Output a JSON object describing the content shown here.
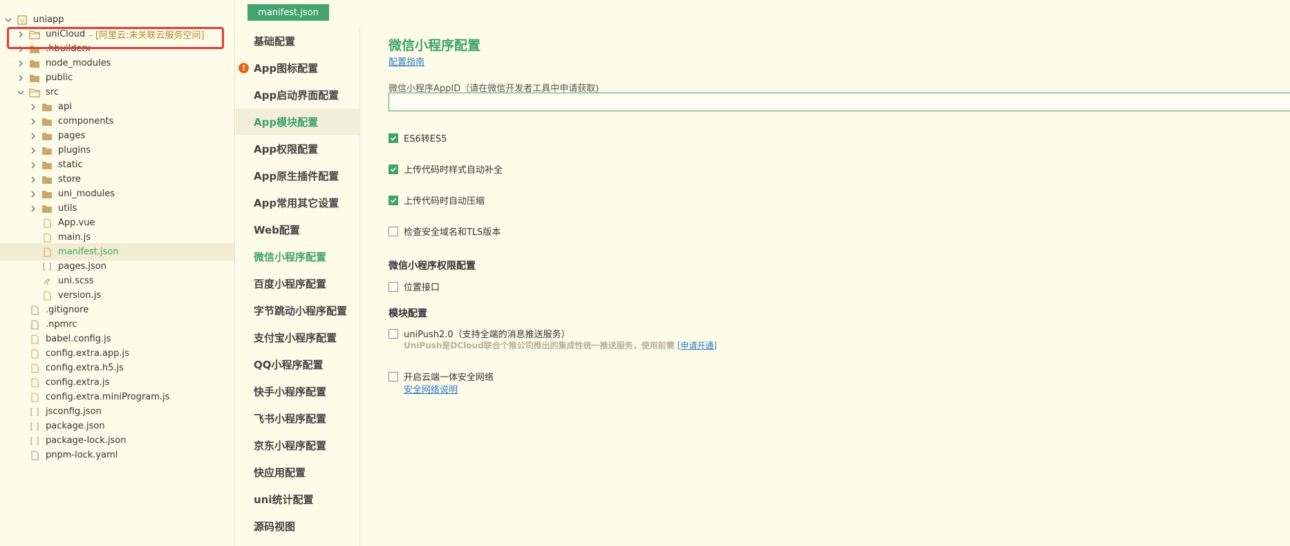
{
  "file_tree": {
    "root": "uniapp",
    "unicloud": {
      "name": "uniCloud",
      "note": "- [阿里云:未关联云服务空间]"
    },
    "items": [
      {
        "name": "uniapp"
      },
      {
        "name": "uniCloud"
      },
      {
        "name": ".hbuilderx"
      },
      {
        "name": "node_modules"
      },
      {
        "name": "public"
      },
      {
        "name": "src"
      },
      {
        "name": "api"
      },
      {
        "name": "components"
      },
      {
        "name": "pages"
      },
      {
        "name": "plugins"
      },
      {
        "name": "static"
      },
      {
        "name": "store"
      },
      {
        "name": "uni_modules"
      },
      {
        "name": "utils"
      },
      {
        "name": "App.vue"
      },
      {
        "name": "main.js"
      },
      {
        "name": "manifest.json"
      },
      {
        "name": "pages.json"
      },
      {
        "name": "uni.scss"
      },
      {
        "name": "version.js"
      },
      {
        "name": ".gitignore"
      },
      {
        "name": ".npmrc"
      },
      {
        "name": "babel.config.js"
      },
      {
        "name": "config.extra.app.js"
      },
      {
        "name": "config.extra.h5.js"
      },
      {
        "name": "config.extra.js"
      },
      {
        "name": "config.extra.miniProgram.js"
      },
      {
        "name": "jsconfig.json"
      },
      {
        "name": "package.json"
      },
      {
        "name": "package-lock.json"
      },
      {
        "name": "pnpm-lock.yaml"
      }
    ]
  },
  "tab": {
    "label": "manifest.json"
  },
  "nav": {
    "items": [
      {
        "label": "基础配置"
      },
      {
        "label": "App图标配置"
      },
      {
        "label": "App启动界面配置"
      },
      {
        "label": "App模块配置"
      },
      {
        "label": "App权限配置"
      },
      {
        "label": "App原生插件配置"
      },
      {
        "label": "App常用其它设置"
      },
      {
        "label": "Web配置"
      },
      {
        "label": "微信小程序配置"
      },
      {
        "label": "百度小程序配置"
      },
      {
        "label": "字节跳动小程序配置"
      },
      {
        "label": "支付宝小程序配置"
      },
      {
        "label": "QQ小程序配置"
      },
      {
        "label": "快手小程序配置"
      },
      {
        "label": "飞书小程序配置"
      },
      {
        "label": "京东小程序配置"
      },
      {
        "label": "快应用配置"
      },
      {
        "label": "uni统计配置"
      },
      {
        "label": "源码视图"
      }
    ],
    "warning_icon": "!"
  },
  "main": {
    "title": "微信小程序配置",
    "guide_link": "配置指南",
    "appid_label": "微信小程序AppID（请在微信开发者工具中申请获取)",
    "appid_value": "",
    "es6": "ES6转ES5",
    "autoprefix": "上传代码时样式自动补全",
    "minify": "上传代码时自动压缩",
    "check_domain": "检查安全域名和TLS版本",
    "perm_section": "微信小程序权限配置",
    "location": "位置接口",
    "module_section": "模块配置",
    "unipush": "uniPush2.0（支持全端的消息推送服务）",
    "unipush_desc": "UniPush是DCloud联合个推公司推出的集成性统一推送服务，使用前需",
    "unipush_link": "[申请开通]",
    "secure_network": "开启云端一体安全网络",
    "secure_link": "安全网络说明",
    "checks": {
      "es6": true,
      "autoprefix": true,
      "minify": true,
      "check_domain": false,
      "location": false,
      "unipush": false,
      "secure_network": false
    }
  },
  "colors": {
    "accent": "#3fa36b",
    "link": "#2a79c9",
    "highlight": "#e53935",
    "warning": "#e6661d"
  }
}
